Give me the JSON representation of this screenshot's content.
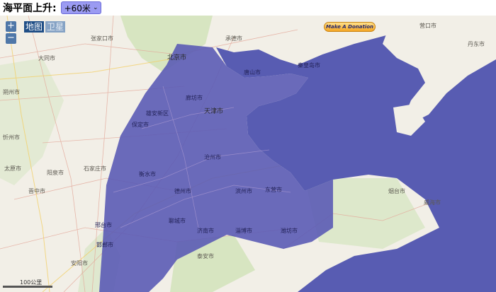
{
  "header": {
    "label": "海平面上升:",
    "sea_level_value": "+60米"
  },
  "map": {
    "zoom_in": "+",
    "zoom_out": "−",
    "map_type_map": "地图",
    "map_type_satellite": "卫星",
    "donate_label": "Make A Donation",
    "scale_label": "100公里",
    "flood_color": "#5b5bb5",
    "sea_color": "#585cb2",
    "land_color": "#f2efe7",
    "places": [
      {
        "name": "北京市",
        "flood": true,
        "big": true
      },
      {
        "name": "天津市",
        "flood": true,
        "big": true
      },
      {
        "name": "唐山市",
        "flood": true,
        "big": false
      },
      {
        "name": "秦皇岛市",
        "flood": true,
        "big": false
      },
      {
        "name": "廊坊市",
        "flood": true,
        "big": false
      },
      {
        "name": "保定市",
        "flood": true,
        "big": false
      },
      {
        "name": "雄安新区",
        "flood": true,
        "big": false
      },
      {
        "name": "沧州市",
        "flood": true,
        "big": false
      },
      {
        "name": "衡水市",
        "flood": true,
        "big": false
      },
      {
        "name": "石家庄市",
        "flood": false,
        "big": false
      },
      {
        "name": "邢台市",
        "flood": true,
        "big": false
      },
      {
        "name": "德州市",
        "flood": true,
        "big": false
      },
      {
        "name": "滨州市",
        "flood": true,
        "big": false
      },
      {
        "name": "东营市",
        "flood": true,
        "big": false
      },
      {
        "name": "济南市",
        "flood": true,
        "big": false
      },
      {
        "name": "淄博市",
        "flood": true,
        "big": false
      },
      {
        "name": "潍坊市",
        "flood": true,
        "big": false
      },
      {
        "name": "聊城市",
        "flood": true,
        "big": false
      },
      {
        "name": "泰安市",
        "flood": false,
        "big": false
      },
      {
        "name": "烟台市",
        "flood": false,
        "big": false
      },
      {
        "name": "威海市",
        "flood": false,
        "big": false
      },
      {
        "name": "大同市",
        "flood": false,
        "big": false
      },
      {
        "name": "朔州市",
        "flood": false,
        "big": false
      },
      {
        "name": "忻州市",
        "flood": false,
        "big": false
      },
      {
        "name": "阳泉市",
        "flood": false,
        "big": false
      },
      {
        "name": "晋中市",
        "flood": false,
        "big": false
      },
      {
        "name": "太原市",
        "flood": false,
        "big": false
      },
      {
        "name": "张家口市",
        "flood": false,
        "big": false
      },
      {
        "name": "承德市",
        "flood": false,
        "big": false
      },
      {
        "name": "营口市",
        "flood": false,
        "big": false
      },
      {
        "name": "丹东市",
        "flood": false,
        "big": false
      },
      {
        "name": "安阳市",
        "flood": false,
        "big": false
      },
      {
        "name": "邯郸市",
        "flood": true,
        "big": false
      }
    ]
  }
}
